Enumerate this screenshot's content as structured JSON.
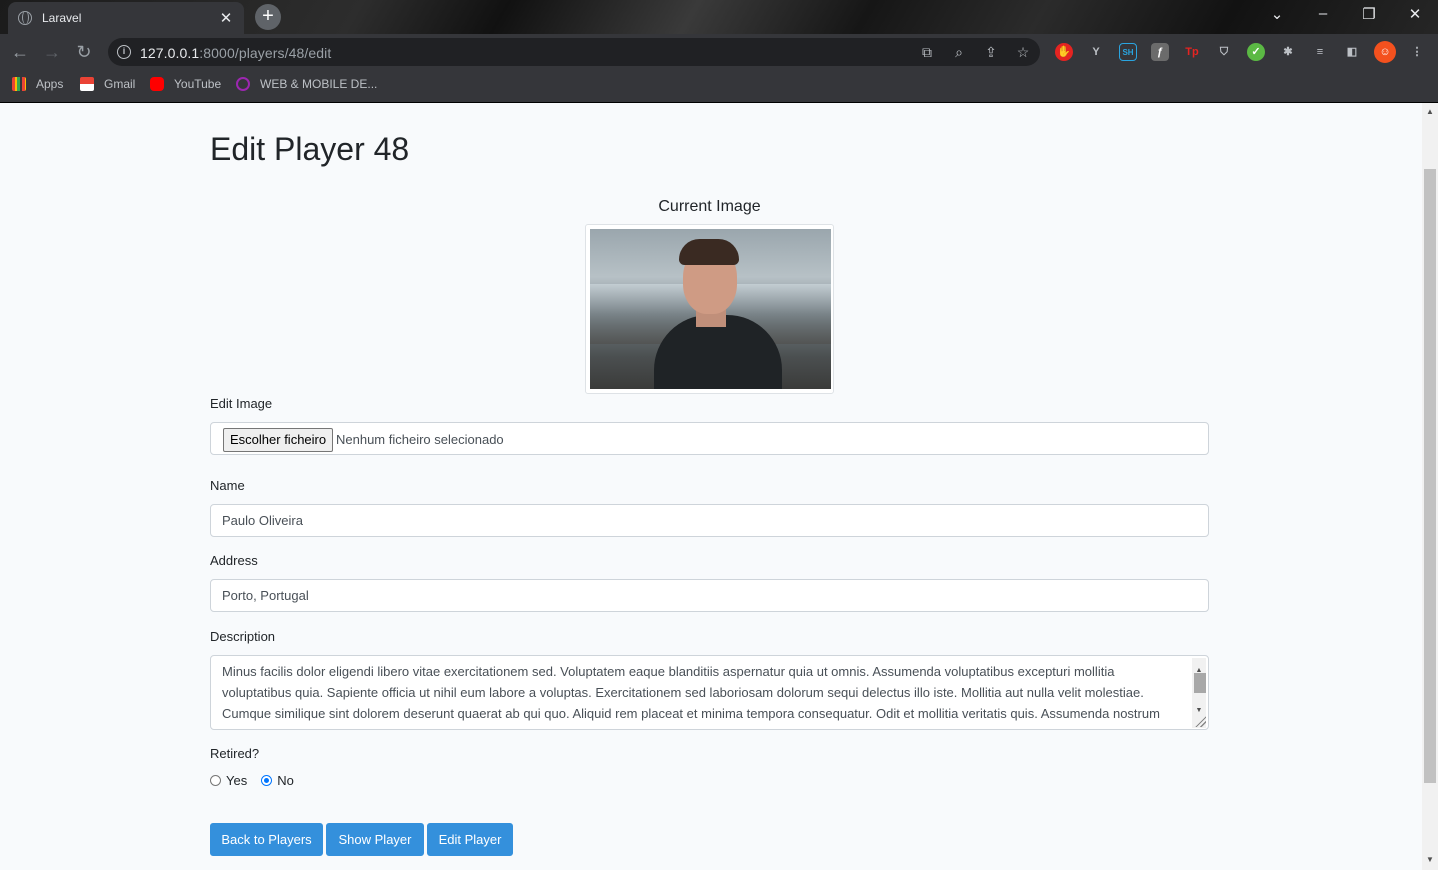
{
  "browser": {
    "tab_title": "Laravel",
    "new_tab_symbol": "+",
    "url_host": "127.0.0.1",
    "url_rest": ":8000/players/48/edit",
    "bookmarks": [
      {
        "label": "Apps",
        "icon": "apps-grid-icon"
      },
      {
        "label": "Gmail",
        "icon": "gmail-icon"
      },
      {
        "label": "YouTube",
        "icon": "youtube-icon"
      },
      {
        "label": "WEB & MOBILE DE...",
        "icon": "bookmark-site-icon"
      }
    ]
  },
  "page": {
    "title": "Edit Player 48",
    "current_image_label": "Current Image",
    "edit_image_label": "Edit Image",
    "file_button_label": "Escolher ficheiro",
    "file_status": "Nenhum ficheiro selecionado",
    "name_label": "Name",
    "name_value": "Paulo Oliveira",
    "address_label": "Address",
    "address_value": "Porto, Portugal",
    "description_label": "Description",
    "description_value": "Minus facilis dolor eligendi libero vitae exercitationem sed. Voluptatem eaque blanditiis aspernatur quia ut omnis. Assumenda voluptatibus excepturi mollitia voluptatibus quia. Sapiente officia ut nihil eum labore a voluptas. Exercitationem sed laboriosam dolorum sequi delectus illo iste. Mollitia aut nulla velit molestiae. Cumque similique sint dolorem deserunt quaerat ab qui quo. Aliquid rem placeat et minima tempora consequatur. Odit et mollitia veritatis quis. Assumenda nostrum",
    "retired_label": "Retired?",
    "retired_options": [
      {
        "label": "Yes",
        "checked": false
      },
      {
        "label": "No",
        "checked": true
      }
    ],
    "buttons": {
      "back": "Back to Players",
      "show": "Show Player",
      "edit": "Edit Player"
    }
  },
  "colors": {
    "primary_button": "#3490dc",
    "page_background": "#f8fafc",
    "radio_accent": "#0075ff"
  }
}
